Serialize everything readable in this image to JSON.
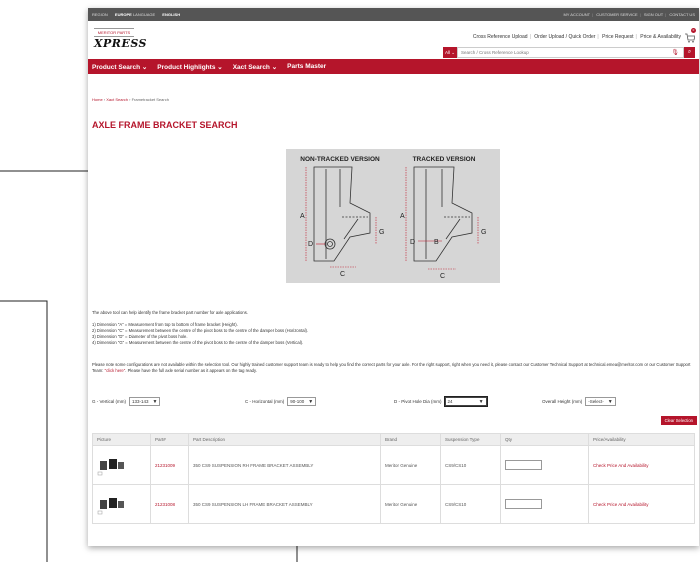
{
  "topbar": {
    "region_label": "REGION",
    "region_value": "EUROPE",
    "language_label": "LANGUAGE",
    "language_value": "ENGLISH",
    "links": [
      "MY ACCOUNT",
      "CUSTOMER SERVICE",
      "SIGN OUT",
      "CONTACT US"
    ]
  },
  "header": {
    "logo_top": "MERITOR PARTS",
    "logo_main": "XPRESS",
    "links": [
      "Cross Reference Upload",
      "Order Upload / Quick Order",
      "Price Request",
      "Price & Availability"
    ],
    "cart_count": "0",
    "search": {
      "scope": "All",
      "placeholder": "Search / Cross Reference Lookup"
    }
  },
  "nav": [
    "Product Search ⌄",
    "Product Highlights ⌄",
    "Xact Search ⌄",
    "Parts Master"
  ],
  "breadcrumb": {
    "home": "Home",
    "sep": " › ",
    "section": "Xact Search",
    "current": "Frametracket Search"
  },
  "page_title": "AXLE FRAME BRACKET SEARCH",
  "diagram": {
    "left_title": "NON-TRACKED VERSION",
    "right_title": "TRACKED VERSION",
    "labels": {
      "a": "A",
      "b": "B",
      "c": "C",
      "d": "D",
      "g": "G"
    }
  },
  "intro": "The above tool can help identify the frame bracket part number for axle applications.",
  "dimensions": [
    "1) Dimension \"A\" = Measurement from top to bottom of frame bracket (Height).",
    "2) Dimension \"C\" = Measurement between the centre of the pivot boss to the centre of the damper boss (Horizontal).",
    "3) Dimension \"D\" = Diameter of the pivot boss hole.",
    "4) Dimension \"G\" = Measurement between the centre of the pivot boss to the centre of the damper boss (Vertical)."
  ],
  "note": {
    "part1": "Please note some configurations are not available within the selection tool. Our highly trained customer support team is ready to help you find the correct parts for your axle. For the right support, right when you need it, please contact our Customer Technical Support at technical.emea@meritor.com or our Customer Support Team: ",
    "link": "\"click here\"",
    "part2": ". Please have the full axle serial number as it appears on the tag ready."
  },
  "filters": [
    {
      "label": "G - Vertical (mm)",
      "value": "133-143"
    },
    {
      "label": "C - Horizontal (mm)",
      "value": "90-100"
    },
    {
      "label": "D - Pivot Hole Dia (mm)",
      "value": "24"
    },
    {
      "label": "Overall Height (mm)",
      "value": "-Select-"
    }
  ],
  "clear_label": "Clear Selection",
  "table": {
    "headers": [
      "Picture",
      "Part#",
      "Part Description",
      "Brand",
      "Suspension Type",
      "Qty",
      "Price/Availability"
    ],
    "rows": [
      {
        "part": "21231009",
        "description": "350 CS9 SUSPENSION RH FRAME BRACKET ASSEMBLY",
        "brand": "Meritor Genuine",
        "suspension": "CS9/CS10",
        "availability": "Check Price And Availability"
      },
      {
        "part": "21231008",
        "description": "350 CS9 SUSPENSION LH FRAME BRACKET ASSEMBLY",
        "brand": "Meritor Genuine",
        "suspension": "CS9/CS10",
        "availability": "Check Price And Availability"
      }
    ]
  }
}
